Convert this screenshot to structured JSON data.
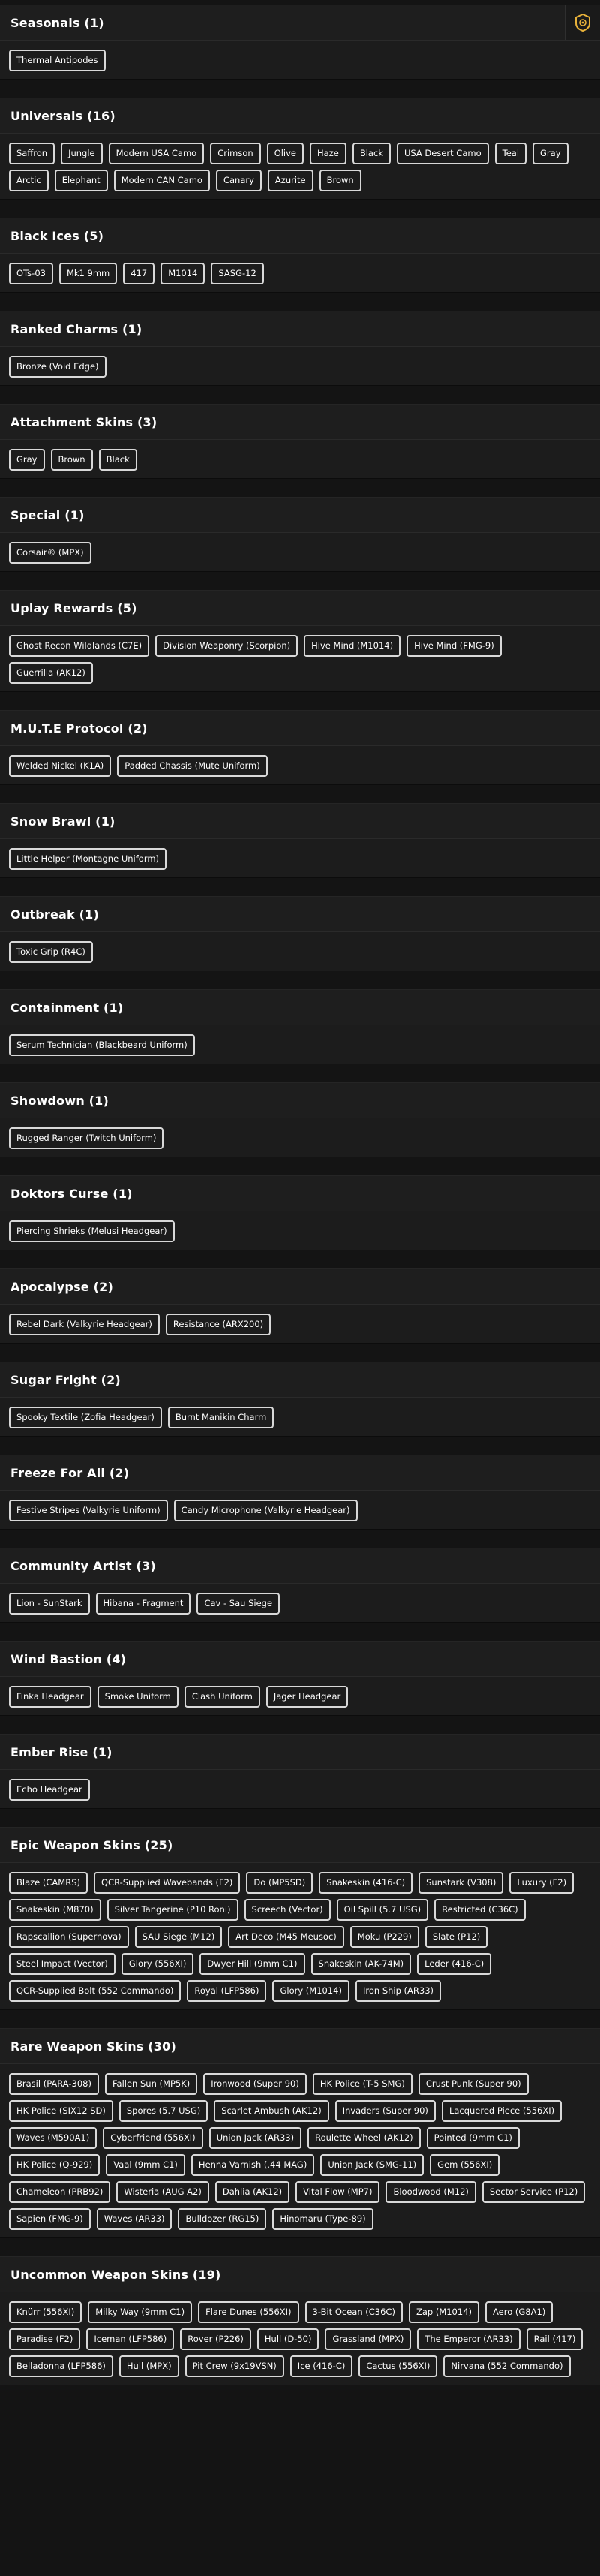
{
  "sections": [
    {
      "title": "Seasonals (1)",
      "items": [
        "Thermal Antipodes"
      ]
    },
    {
      "title": "Universals (16)",
      "items": [
        "Saffron",
        "Jungle",
        "Modern USA Camo",
        "Crimson",
        "Olive",
        "Haze",
        "Black",
        "USA Desert Camo",
        "Teal",
        "Gray",
        "Arctic",
        "Elephant",
        "Modern CAN Camo",
        "Canary",
        "Azurite",
        "Brown"
      ]
    },
    {
      "title": "Black Ices (5)",
      "items": [
        "OTs-03",
        "Mk1 9mm",
        "417",
        "M1014",
        "SASG-12"
      ]
    },
    {
      "title": "Ranked Charms (1)",
      "items": [
        "Bronze (Void Edge)"
      ]
    },
    {
      "title": "Attachment Skins (3)",
      "items": [
        "Gray",
        "Brown",
        "Black"
      ]
    },
    {
      "title": "Special (1)",
      "items": [
        "Corsair® (MPX)"
      ]
    },
    {
      "title": "Uplay Rewards (5)",
      "items": [
        "Ghost Recon Wildlands (C7E)",
        "Division Weaponry (Scorpion)",
        "Hive Mind (M1014)",
        "Hive Mind (FMG-9)",
        "Guerrilla (AK12)"
      ]
    },
    {
      "title": "M.U.T.E Protocol (2)",
      "items": [
        "Welded Nickel (K1A)",
        "Padded Chassis (Mute Uniform)"
      ]
    },
    {
      "title": "Snow Brawl (1)",
      "items": [
        "Little Helper (Montagne Uniform)"
      ]
    },
    {
      "title": "Outbreak (1)",
      "items": [
        "Toxic Grip (R4C)"
      ]
    },
    {
      "title": "Containment (1)",
      "items": [
        "Serum Technician (Blackbeard Uniform)"
      ]
    },
    {
      "title": "Showdown (1)",
      "items": [
        "Rugged Ranger (Twitch Uniform)"
      ]
    },
    {
      "title": "Doktors Curse (1)",
      "items": [
        "Piercing Shrieks (Melusi Headgear)"
      ]
    },
    {
      "title": "Apocalypse (2)",
      "items": [
        "Rebel Dark (Valkyrie Headgear)",
        "Resistance (ARX200)"
      ]
    },
    {
      "title": "Sugar Fright (2)",
      "items": [
        "Spooky Textile (Zofia Headgear)",
        "Burnt Manikin Charm"
      ]
    },
    {
      "title": "Freeze For All (2)",
      "items": [
        "Festive Stripes (Valkyrie Uniform)",
        "Candy Microphone (Valkyrie Headgear)"
      ]
    },
    {
      "title": "Community Artist (3)",
      "items": [
        "Lion - SunStark",
        "Hibana - Fragment",
        "Cav - Sau Siege"
      ]
    },
    {
      "title": "Wind Bastion (4)",
      "items": [
        "Finka Headgear",
        "Smoke Uniform",
        "Clash Uniform",
        "Jager Headgear"
      ]
    },
    {
      "title": "Ember Rise (1)",
      "items": [
        "Echo Headgear"
      ]
    },
    {
      "title": "Epic Weapon Skins (25)",
      "items": [
        "Blaze (CAMRS)",
        "QCR-Supplied Wavebands (F2)",
        "Do (MP5SD)",
        "Snakeskin (416-C)",
        "Sunstark (V308)",
        "Luxury (F2)",
        "Snakeskin (M870)",
        "Silver Tangerine (P10 Roni)",
        "Screech (Vector)",
        "Oil Spill (5.7 USG)",
        "Restricted (C36C)",
        "Rapscallion (Supernova)",
        "SAU Siege (M12)",
        "Art Deco (M45 Meusoc)",
        "Moku (P229)",
        "Slate (P12)",
        "Steel Impact (Vector)",
        "Glory (556XI)",
        "Dwyer Hill (9mm C1)",
        "Snakeskin (AK-74M)",
        "Leder (416-C)",
        "QCR-Supplied Bolt (552 Commando)",
        "Royal (LFP586)",
        "Glory (M1014)",
        "Iron Ship (AR33)"
      ]
    },
    {
      "title": "Rare Weapon Skins (30)",
      "items": [
        "Brasil (PARA-308)",
        "Fallen Sun (MP5K)",
        "Ironwood (Super 90)",
        "HK Police (T-5 SMG)",
        "Crust Punk (Super 90)",
        "HK Police (SIX12 SD)",
        "Spores (5.7 USG)",
        "Scarlet Ambush (AK12)",
        "Invaders (Super 90)",
        "Lacquered Piece (556XI)",
        "Waves (M590A1)",
        "Cyberfriend (556XI)",
        "Union Jack (AR33)",
        "Roulette Wheel (AK12)",
        "Pointed (9mm C1)",
        "HK Police (Q-929)",
        "Vaal (9mm C1)",
        "Henna Varnish (.44 MAG)",
        "Union Jack (SMG-11)",
        "Gem (556XI)",
        "Chameleon (PRB92)",
        "Wisteria (AUG A2)",
        "Dahlia (AK12)",
        "Vital Flow (MP7)",
        "Bloodwood (M12)",
        "Sector Service (P12)",
        "Sapien (FMG-9)",
        "Waves (AR33)",
        "Bulldozer (RG15)",
        "Hinomaru (Type-89)"
      ]
    },
    {
      "title": "Uncommon Weapon Skins (19)",
      "items": [
        "Knürr (556XI)",
        "Milky Way (9mm C1)",
        "Flare Dunes (556XI)",
        "3-Bit Ocean (C36C)",
        "Zap (M1014)",
        "Aero (G8A1)",
        "Paradise (F2)",
        "Iceman (LFP586)",
        "Rover (P226)",
        "Hull (D-50)",
        "Grassland (MPX)",
        "The Emperor (AR33)",
        "Rail (417)",
        "Belladonna (LFP586)",
        "Hull (MPX)",
        "Pit Crew (9x19VSN)",
        "Ice (416-C)",
        "Cactus (556XI)",
        "Nirvana (552 Commando)"
      ]
    }
  ],
  "corner_button_icon": "rainbow-six-badge-icon",
  "accent_color": "#e8b23a"
}
